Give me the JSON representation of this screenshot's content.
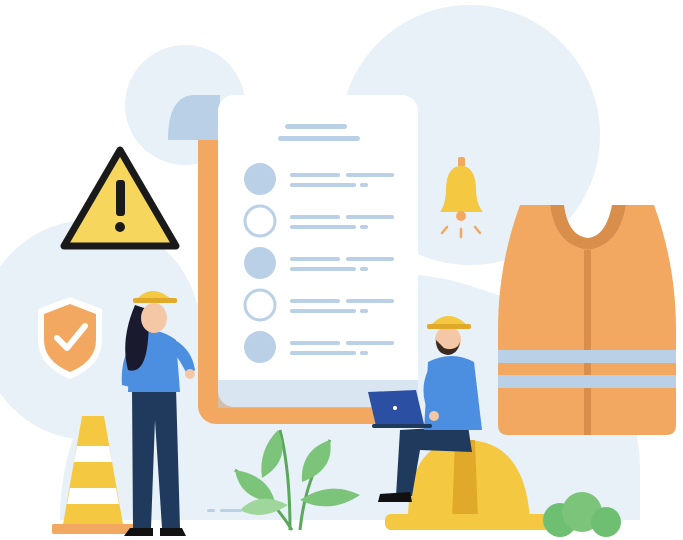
{
  "illustration": {
    "subject": "workplace-safety-checklist",
    "checklist": {
      "rows": [
        {
          "state": "filled"
        },
        {
          "state": "empty"
        },
        {
          "state": "filled"
        },
        {
          "state": "empty"
        },
        {
          "state": "filled"
        }
      ]
    },
    "icons": [
      "warning-icon",
      "shield-check-icon",
      "bell-icon",
      "laptop-icon",
      "safety-vest-icon",
      "traffic-cone-icon",
      "hard-hat-icon"
    ],
    "colors": {
      "background_blob": "#e8f0f8",
      "accent_orange": "#f2a860",
      "accent_yellow": "#f5c842",
      "warning_yellow": "#f6d65c",
      "paper": "#ffffff",
      "navy": "#1f3a5c",
      "shirt_blue": "#4c8fe0",
      "skin": "#f4c8a6",
      "plant_green": "#7cc47a",
      "reflective_stripe": "#b9d0e6"
    }
  }
}
